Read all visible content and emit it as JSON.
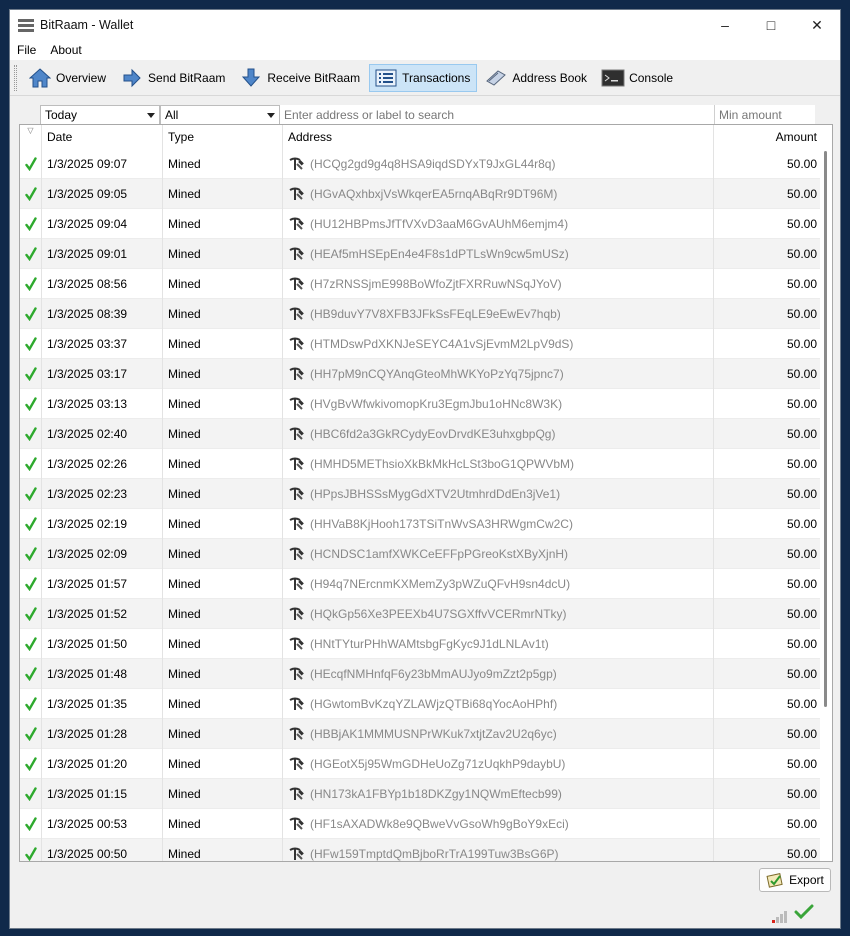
{
  "window": {
    "title": "BitRaam - Wallet",
    "minimize": "–",
    "maximize": "□",
    "close": "✕"
  },
  "menu": {
    "file": "File",
    "about": "About"
  },
  "toolbar": {
    "overview": "Overview",
    "send": "Send BitRaam",
    "receive": "Receive BitRaam",
    "transactions": "Transactions",
    "address_book": "Address Book",
    "console": "Console",
    "active": "transactions"
  },
  "filters": {
    "date": "Today",
    "type": "All",
    "search_placeholder": "Enter address or label to search",
    "min_amount_placeholder": "Min amount"
  },
  "table": {
    "headers": {
      "date": "Date",
      "type": "Type",
      "address": "Address",
      "amount": "Amount"
    },
    "sort_indicator": "▽",
    "rows": [
      {
        "date": "1/3/2025 09:07",
        "type": "Mined",
        "address": "(HCQg2gd9g4q8HSA9iqdSDYxT9JxGL44r8q)",
        "amount": "50.00"
      },
      {
        "date": "1/3/2025 09:05",
        "type": "Mined",
        "address": "(HGvAQxhbxjVsWkqerEA5rnqABqRr9DT96M)",
        "amount": "50.00"
      },
      {
        "date": "1/3/2025 09:04",
        "type": "Mined",
        "address": "(HU12HBPmsJfTfVXvD3aaM6GvAUhM6emjm4)",
        "amount": "50.00"
      },
      {
        "date": "1/3/2025 09:01",
        "type": "Mined",
        "address": "(HEAf5mHSEpEn4e4F8s1dPTLsWn9cw5mUSz)",
        "amount": "50.00"
      },
      {
        "date": "1/3/2025 08:56",
        "type": "Mined",
        "address": "(H7zRNSSjmE998BoWfoZjtFXRRuwNSqJYoV)",
        "amount": "50.00"
      },
      {
        "date": "1/3/2025 08:39",
        "type": "Mined",
        "address": "(HB9duvY7V8XFB3JFkSsFEqLE9eEwEv7hqb)",
        "amount": "50.00"
      },
      {
        "date": "1/3/2025 03:37",
        "type": "Mined",
        "address": "(HTMDswPdXKNJeSEYC4A1vSjEvmM2LpV9dS)",
        "amount": "50.00"
      },
      {
        "date": "1/3/2025 03:17",
        "type": "Mined",
        "address": "(HH7pM9nCQYAnqGteoMhWKYoPzYq75jpnc7)",
        "amount": "50.00"
      },
      {
        "date": "1/3/2025 03:13",
        "type": "Mined",
        "address": "(HVgBvWfwkivomopKru3EgmJbu1oHNc8W3K)",
        "amount": "50.00"
      },
      {
        "date": "1/3/2025 02:40",
        "type": "Mined",
        "address": "(HBC6fd2a3GkRCydyEovDrvdKE3uhxgbpQg)",
        "amount": "50.00"
      },
      {
        "date": "1/3/2025 02:26",
        "type": "Mined",
        "address": "(HMHD5METhsioXkBkMkHcLSt3boG1QPWVbM)",
        "amount": "50.00"
      },
      {
        "date": "1/3/2025 02:23",
        "type": "Mined",
        "address": "(HPpsJBHSSsMygGdXTV2UtmhrdDdEn3jVe1)",
        "amount": "50.00"
      },
      {
        "date": "1/3/2025 02:19",
        "type": "Mined",
        "address": "(HHVaB8KjHooh173TSiTnWvSA3HRWgmCw2C)",
        "amount": "50.00"
      },
      {
        "date": "1/3/2025 02:09",
        "type": "Mined",
        "address": "(HCNDSC1amfXWKCeEFFpPGreoKstXByXjnH)",
        "amount": "50.00"
      },
      {
        "date": "1/3/2025 01:57",
        "type": "Mined",
        "address": "(H94q7NErcnmKXMemZy3pWZuQFvH9sn4dcU)",
        "amount": "50.00"
      },
      {
        "date": "1/3/2025 01:52",
        "type": "Mined",
        "address": "(HQkGp56Xe3PEEXb4U7SGXffvVCERmrNTky)",
        "amount": "50.00"
      },
      {
        "date": "1/3/2025 01:50",
        "type": "Mined",
        "address": "(HNtTYturPHhWAMtsbgFgKyc9J1dLNLAv1t)",
        "amount": "50.00"
      },
      {
        "date": "1/3/2025 01:48",
        "type": "Mined",
        "address": "(HEcqfNMHnfqF6y23bMmAUJyo9mZzt2p5gp)",
        "amount": "50.00"
      },
      {
        "date": "1/3/2025 01:35",
        "type": "Mined",
        "address": "(HGwtomBvKzqYZLAWjzQTBi68qYocAoHPhf)",
        "amount": "50.00"
      },
      {
        "date": "1/3/2025 01:28",
        "type": "Mined",
        "address": "(HBBjAK1MMMUSNPrWKuk7xtjtZav2U2q6yc)",
        "amount": "50.00"
      },
      {
        "date": "1/3/2025 01:20",
        "type": "Mined",
        "address": "(HGEotX5j95WmGDHeUoZg71zUqkhP9daybU)",
        "amount": "50.00"
      },
      {
        "date": "1/3/2025 01:15",
        "type": "Mined",
        "address": "(HN173kA1FBYp1b18DKZgy1NQWmEftecb99)",
        "amount": "50.00"
      },
      {
        "date": "1/3/2025 00:53",
        "type": "Mined",
        "address": "(HF1sAXADWk8e9QBweVvGsoWh9gBoY9xEci)",
        "amount": "50.00"
      },
      {
        "date": "1/3/2025 00:50",
        "type": "Mined",
        "address": "(HFw159TmptdQmBjboRrTrA199Tuw3BsG6P)",
        "amount": "50.00"
      }
    ]
  },
  "export": {
    "label": "Export"
  },
  "colors": {
    "confirmed_check": "#2eaa2e",
    "signal_bars": "#d9251d",
    "sync_check": "#3aa53a",
    "accent": "#cce4f7"
  },
  "icons": {
    "overview": "home-icon",
    "send": "send-arrow-icon",
    "receive": "receive-arrow-icon",
    "transactions": "list-icon",
    "address_book": "address-book-icon",
    "console": "console-icon",
    "mined": "pickaxe-hammer-icon",
    "status": "checkmark-icon",
    "export": "export-icon"
  }
}
